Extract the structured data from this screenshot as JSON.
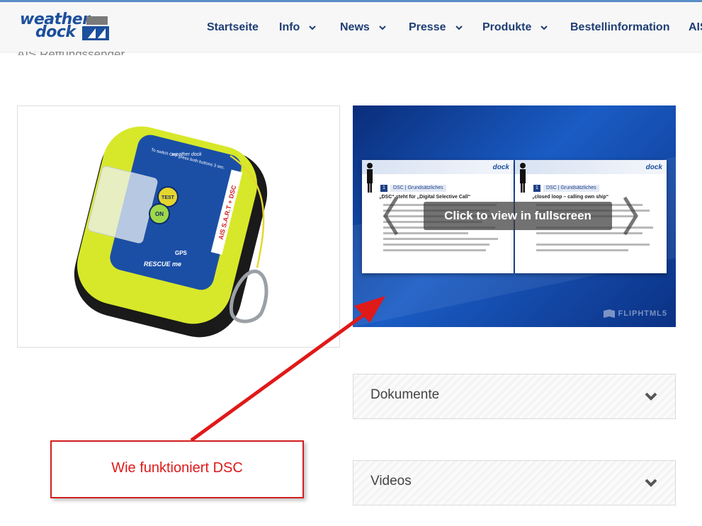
{
  "header": {
    "logo_top": "weather",
    "logo_bottom": "dock",
    "nav": [
      {
        "label": "Startseite",
        "has_dropdown": false
      },
      {
        "label": "Info",
        "has_dropdown": true
      },
      {
        "label": "News",
        "has_dropdown": true
      },
      {
        "label": "Presse",
        "has_dropdown": true
      },
      {
        "label": "Produkte",
        "has_dropdown": true
      },
      {
        "label": "Bestellinformation",
        "has_dropdown": false
      },
      {
        "label": "AIS",
        "has_dropdown": false
      }
    ]
  },
  "page": {
    "subtitle": "AIS Rettungssender"
  },
  "product": {
    "device_brand": "weather dock",
    "device_model": "RESCUE me",
    "device_text_switch": "To switch OFF press both buttons 3 sec.",
    "device_label": "AIS S.A.R.T + DSC",
    "device_btn_test": "TEST",
    "device_btn_on": "ON",
    "device_gps": "GPS"
  },
  "flipbook": {
    "overlay_text": "Click to view in fullscreen",
    "watermark": "FLIPHTML5",
    "left_page": {
      "number": "1",
      "section": "DSC | Grundsätzliches",
      "title": "„DSC“ steht für „Digital Selective Call“"
    },
    "right_page": {
      "number": "1",
      "section": "DSC | Grundsätzliches",
      "title": "„closed loop – calling own ship“"
    }
  },
  "accordions": [
    {
      "label": "Dokumente"
    },
    {
      "label": "Videos"
    }
  ],
  "annotation": {
    "text": "Wie funktioniert DSC",
    "color": "#e01919"
  },
  "colors": {
    "nav_text": "#1f3e73",
    "brand_blue": "#1c4f9c",
    "device_yellow": "#d7e82a",
    "annotation_red": "#e01919"
  }
}
